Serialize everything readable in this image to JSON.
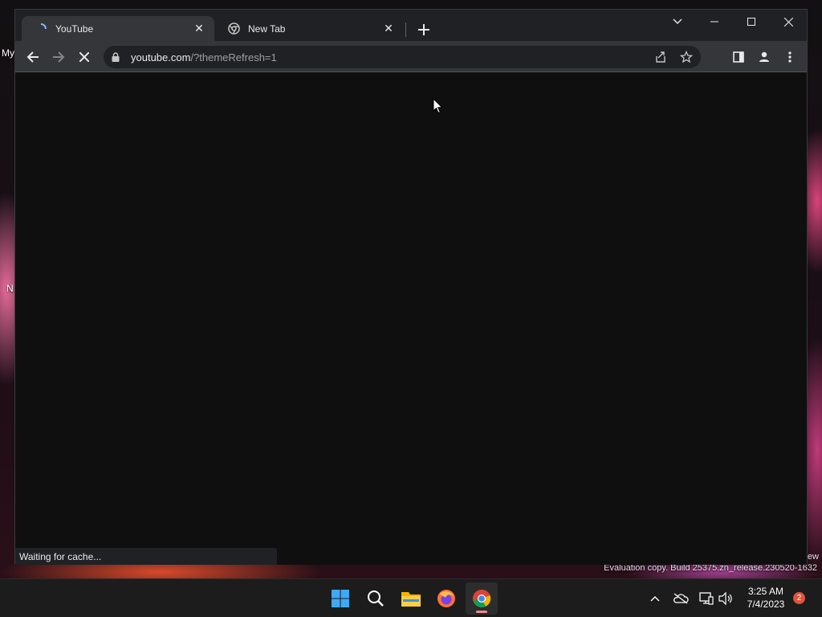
{
  "desktop": {
    "label_top": "My",
    "label_mid": "N",
    "watermark": "Evaluation copy. Build 25375.zn_release.230520-1632",
    "watermark_right": "ew"
  },
  "browser": {
    "tabs": [
      {
        "title": "YouTube",
        "icon": "youtube-loading-icon",
        "active": true
      },
      {
        "title": "New Tab",
        "icon": "chrome-icon",
        "active": false
      }
    ],
    "url_host": "youtube.com",
    "url_path": "/?themeRefresh=1",
    "status": "Waiting for cache..."
  },
  "taskbar": {
    "apps": [
      "windows-start-icon",
      "search-icon",
      "file-explorer-icon",
      "firefox-icon",
      "chrome-icon"
    ],
    "active_app": "chrome-icon",
    "time": "3:25 AM",
    "date": "7/4/2023",
    "notification_count": "2"
  },
  "colors": {
    "accent": "#f28b82",
    "tab_active": "#35363a",
    "tabstrip": "#202124",
    "content": "#0f0f0f"
  }
}
